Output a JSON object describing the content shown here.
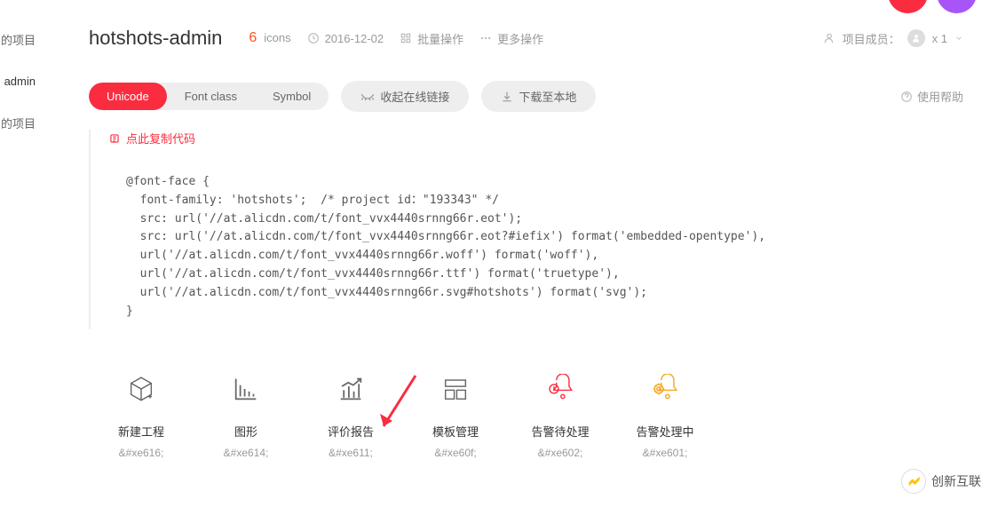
{
  "sidebar": {
    "items": [
      "的项目",
      "admin",
      "的项目"
    ]
  },
  "header": {
    "title": "hotshots-admin",
    "count": "6",
    "count_label": "icons",
    "date": "2016-12-02",
    "batch": "批量操作",
    "more": "更多操作",
    "members_label": "项目成员：",
    "members_count": "x 1"
  },
  "toolbar": {
    "tabs": [
      "Unicode",
      "Font class",
      "Symbol"
    ],
    "collapse_link": "收起在线链接",
    "download": "下载至本地",
    "help": "使用帮助"
  },
  "code": {
    "copy_label": "点此复制代码",
    "content": "@font-face {\n  font-family: 'hotshots';  /* project id：\"193343\" */\n  src: url('//at.alicdn.com/t/font_vvx4440srnng66r.eot');\n  src: url('//at.alicdn.com/t/font_vvx4440srnng66r.eot?#iefix') format('embedded-opentype'),\n  url('//at.alicdn.com/t/font_vvx4440srnng66r.woff') format('woff'),\n  url('//at.alicdn.com/t/font_vvx4440srnng66r.ttf') format('truetype'),\n  url('//at.alicdn.com/t/font_vvx4440srnng66r.svg#hotshots') format('svg');\n}"
  },
  "icons": [
    {
      "name": "新建工程",
      "code": "&#xe616;"
    },
    {
      "name": "图形",
      "code": "&#xe614;"
    },
    {
      "name": "评价报告",
      "code": "&#xe611;"
    },
    {
      "name": "模板管理",
      "code": "&#xe60f;"
    },
    {
      "name": "告警待处理",
      "code": "&#xe602;"
    },
    {
      "name": "告警处理中",
      "code": "&#xe601;"
    }
  ],
  "watermark": "创新互联"
}
